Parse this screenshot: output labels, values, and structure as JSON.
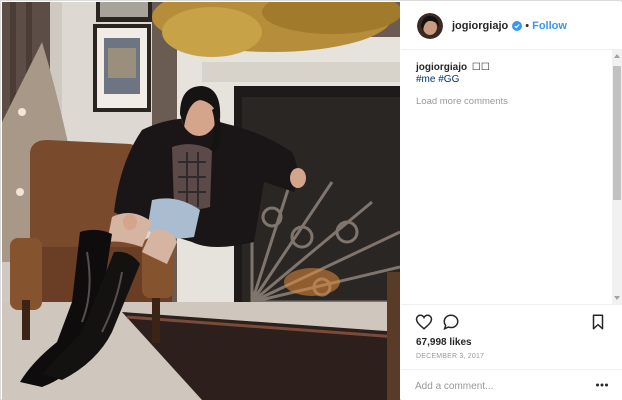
{
  "post": {
    "username": "jogiorgiajo",
    "verified": true,
    "separator": "•",
    "follow_label": "Follow",
    "photo_alt": "Woman seated on a chair arm by a fireplace"
  },
  "caption": {
    "username": "jogiorgiajo",
    "text": "☐☐",
    "hashtags": [
      "#me",
      "#GG"
    ]
  },
  "comments": {
    "load_more_label": "Load more comments"
  },
  "actions": {
    "icons": [
      "heart-icon",
      "comment-icon",
      "bookmark-icon"
    ]
  },
  "likes_text": "67,998 likes",
  "date_text": "DECEMBER 3, 2017",
  "add_comment": {
    "placeholder": "Add a comment..."
  },
  "colors": {
    "accent": "#3897f0",
    "hashtag": "#003569",
    "muted": "#999999",
    "text": "#262626",
    "divider": "#efefef"
  }
}
